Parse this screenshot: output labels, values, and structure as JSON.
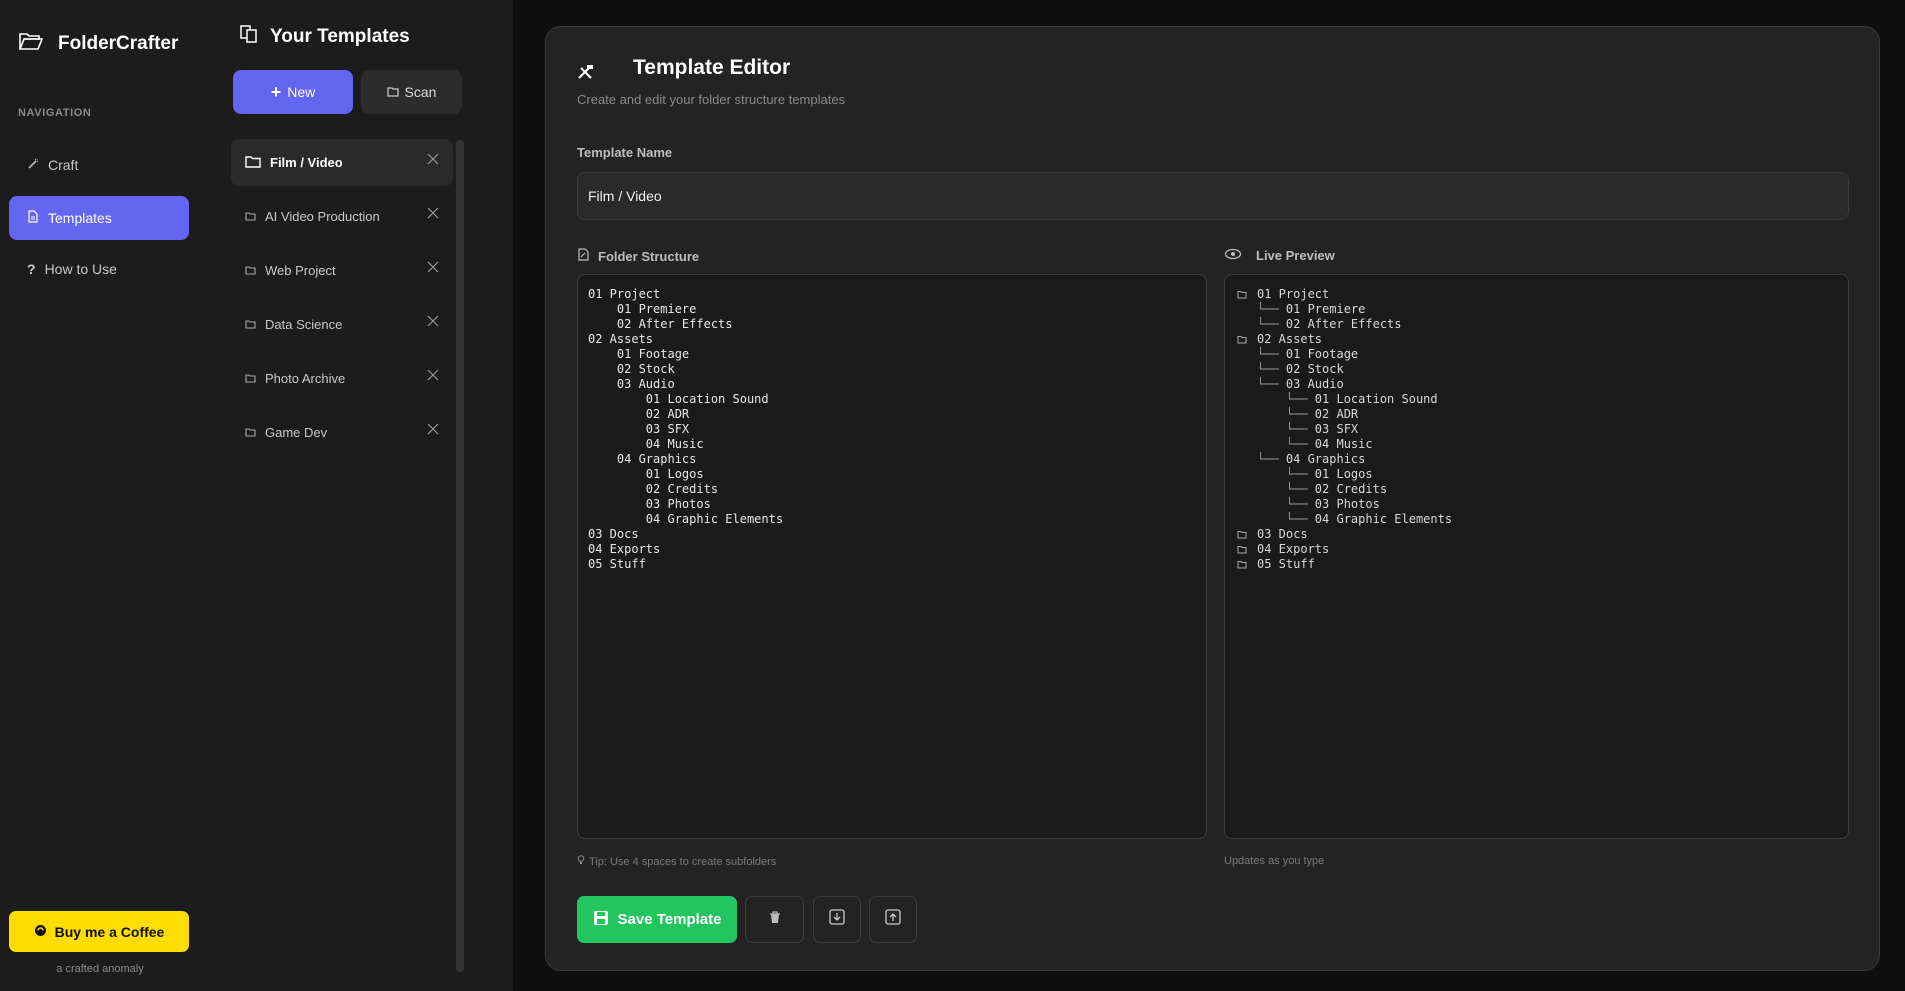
{
  "app": {
    "name": "FolderCrafter"
  },
  "nav": {
    "heading": "NAVIGATION",
    "items": [
      {
        "label": "Craft",
        "icon": "wand-icon"
      },
      {
        "label": "Templates",
        "icon": "document-icon",
        "active": true
      },
      {
        "label": "How to Use",
        "icon": "question-icon"
      }
    ],
    "coffee_label": "Buy me a Coffee",
    "tagline": "a crafted anomaly"
  },
  "templates": {
    "title": "Your Templates",
    "new_label": "New",
    "scan_label": "Scan",
    "items": [
      {
        "label": "Film / Video",
        "active": true
      },
      {
        "label": "AI Video Production"
      },
      {
        "label": "Web Project"
      },
      {
        "label": "Data Science"
      },
      {
        "label": "Photo Archive"
      },
      {
        "label": "Game Dev"
      }
    ]
  },
  "editor": {
    "title": "Template Editor",
    "subtitle": "Create and edit your folder structure templates",
    "name_label": "Template Name",
    "name_value": "Film / Video",
    "structure_label": "Folder Structure",
    "preview_label": "Live Preview",
    "structure_text": "01 Project\n    01 Premiere\n    02 After Effects\n02 Assets\n    01 Footage\n    02 Stock\n    03 Audio\n        01 Location Sound\n        02 ADR\n        03 SFX\n        04 Music\n    04 Graphics\n        01 Logos\n        02 Credits\n        03 Photos\n        04 Graphic Elements\n03 Docs\n04 Exports\n05 Stuff",
    "preview_lines": [
      {
        "text": "01 Project",
        "prefix": "",
        "root": true
      },
      {
        "text": "01 Premiere",
        "prefix": "└── ",
        "root": false
      },
      {
        "text": "02 After Effects",
        "prefix": "└── ",
        "root": false
      },
      {
        "text": "02 Assets",
        "prefix": "",
        "root": true
      },
      {
        "text": "01 Footage",
        "prefix": "└── ",
        "root": false
      },
      {
        "text": "02 Stock",
        "prefix": "└── ",
        "root": false
      },
      {
        "text": "03 Audio",
        "prefix": "└── ",
        "root": false
      },
      {
        "text": "01 Location Sound",
        "prefix": "    └── ",
        "root": false
      },
      {
        "text": "02 ADR",
        "prefix": "    └── ",
        "root": false
      },
      {
        "text": "03 SFX",
        "prefix": "    └── ",
        "root": false
      },
      {
        "text": "04 Music",
        "prefix": "    └── ",
        "root": false
      },
      {
        "text": "04 Graphics",
        "prefix": "└── ",
        "root": false
      },
      {
        "text": "01 Logos",
        "prefix": "    └── ",
        "root": false
      },
      {
        "text": "02 Credits",
        "prefix": "    └── ",
        "root": false
      },
      {
        "text": "03 Photos",
        "prefix": "    └── ",
        "root": false
      },
      {
        "text": "04 Graphic Elements",
        "prefix": "    └── ",
        "root": false
      },
      {
        "text": "03 Docs",
        "prefix": "",
        "root": true
      },
      {
        "text": "04 Exports",
        "prefix": "",
        "root": true
      },
      {
        "text": "05 Stuff",
        "prefix": "",
        "root": true
      }
    ],
    "tip": "Tip: Use 4 spaces to create subfolders",
    "updates_hint": "Updates as you type",
    "save_label": "Save Template"
  },
  "colors": {
    "accent": "#6366f1",
    "save": "#22c55e",
    "coffee": "#ffdd00"
  }
}
